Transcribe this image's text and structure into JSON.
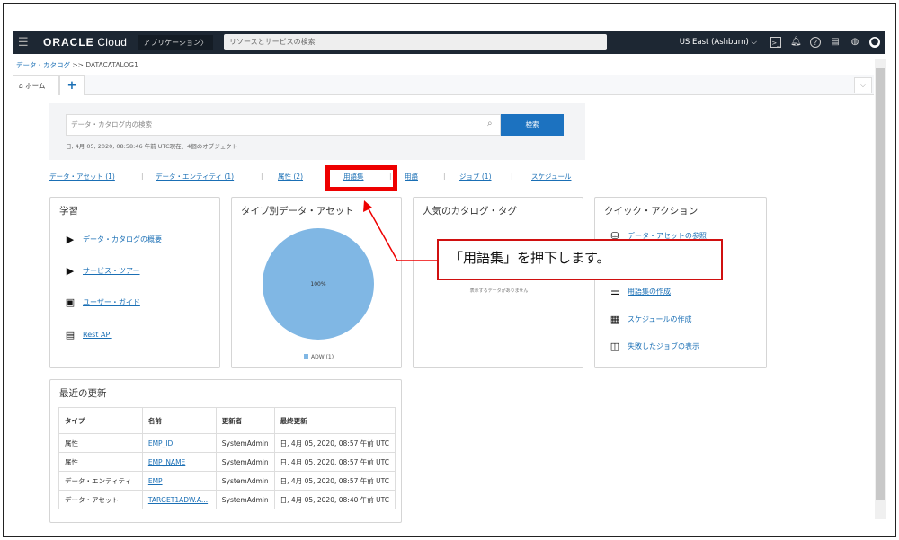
{
  "topbar": {
    "brand_bold": "ORACLE",
    "brand_light": "Cloud",
    "apps": "アプリケーション〉",
    "search_placeholder": "リソースとサービスの検索",
    "region": "US East (Ashburn) ⌵"
  },
  "breadcrumb": {
    "root": "データ・カタログ",
    "sep": ">>",
    "current": "DATACATALOG1"
  },
  "tabs": {
    "home": "ホーム",
    "add": "+",
    "menu": "⌵"
  },
  "search": {
    "placeholder": "データ・カタログ内の検索",
    "button": "検索",
    "info": "日, 4月 05, 2020, 08:58:46 午前 UTC現在、4個のオブジェクト"
  },
  "links": [
    "データ・アセット (1)",
    "データ・エンティティ (1)",
    "属性 (2)",
    "用語集",
    "用語",
    "ジョブ (1)",
    "スケジュール"
  ],
  "learn": {
    "title": "学習",
    "items": [
      "データ・カタログの概要",
      "サービス・ツアー",
      "ユーザー・ガイド",
      "Rest API"
    ]
  },
  "type_assets": {
    "title": "タイプ別データ・アセット"
  },
  "tags": {
    "title": "人気のカタログ・タグ",
    "empty": "表示するデータがありません"
  },
  "quick": {
    "title": "クイック・アクション",
    "items": [
      "データ・アセットの参照",
      "用語集の作成",
      "スケジュールの作成",
      "失敗したジョブの表示"
    ]
  },
  "recent": {
    "title": "最近の更新",
    "headers": [
      "タイプ",
      "名前",
      "更新者",
      "最終更新"
    ],
    "rows": [
      [
        "属性",
        "EMP_ID",
        "SystemAdmin",
        "日, 4月 05, 2020, 08:57 午前 UTC"
      ],
      [
        "属性",
        "EMP_NAME",
        "SystemAdmin",
        "日, 4月 05, 2020, 08:57 午前 UTC"
      ],
      [
        "データ・エンティティ",
        "EMP",
        "SystemAdmin",
        "日, 4月 05, 2020, 08:57 午前 UTC"
      ],
      [
        "データ・アセット",
        "TARGET1ADW.A...",
        "SystemAdmin",
        "日, 4月 05, 2020, 08:40 午前 UTC"
      ]
    ]
  },
  "callout": "「用語集」を押下します。",
  "chart_data": {
    "type": "pie",
    "title": "タイプ別データ・アセット",
    "categories": [
      "ADW"
    ],
    "values": [
      1
    ],
    "labels": [
      "100%"
    ],
    "legend": [
      "ADW (1)"
    ],
    "colors": [
      "#80b7e4"
    ]
  }
}
